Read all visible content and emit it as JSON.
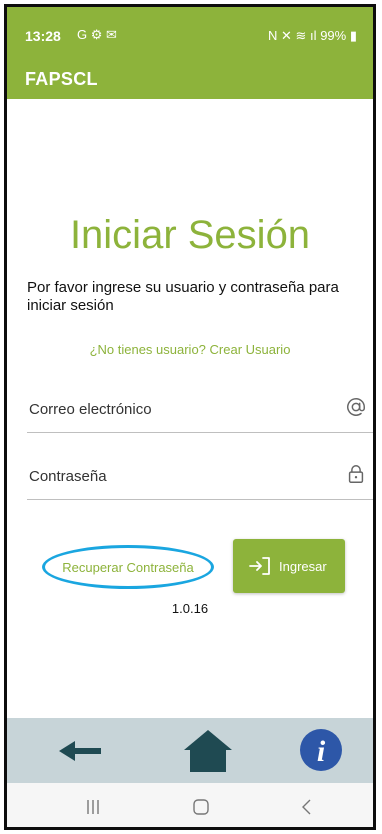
{
  "status_bar": {
    "time": "13:28",
    "left_icons": "G ⚙ ✉",
    "right_icons": "N ✕ ≋ ıl",
    "battery": "99%"
  },
  "app_bar": {
    "title": "FAPSCL"
  },
  "login": {
    "title": "Iniciar Sesión",
    "subtitle": "Por favor ingrese su usuario y contraseña para iniciar sesión",
    "create_user_link": "¿No tienes usuario? Crear Usuario",
    "email_placeholder": "Correo electrónico",
    "password_placeholder": "Contraseña",
    "recover_password": "Recuperar Contraseña",
    "login_button": "Ingresar",
    "version": "1.0.16"
  },
  "bottom_nav": {
    "icons": [
      "back-arrow-icon",
      "home-icon",
      "info-icon"
    ]
  },
  "colors": {
    "brand_green": "#8db33b",
    "highlight_blue": "#1aa6e0",
    "nav_bg": "#c7d4d8",
    "nav_icon": "#1f4a52",
    "info_blue": "#2d57a8"
  }
}
